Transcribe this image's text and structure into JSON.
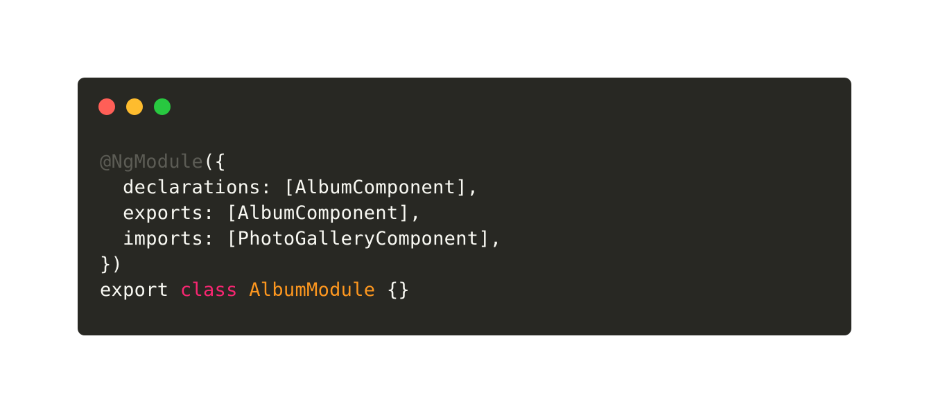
{
  "colors": {
    "page_background": "#ffffff",
    "editor_background": "#282823",
    "close_dot": "#ff5f57",
    "minimize_dot": "#febc2e",
    "maximize_dot": "#28c840",
    "plain_text": "#f8f8f2",
    "decorator": "#5c5c55",
    "keyword": "#f92672",
    "class_name": "#fd971f"
  },
  "window_controls": [
    {
      "name": "close",
      "icon": "close-dot-icon"
    },
    {
      "name": "minimize",
      "icon": "minimize-dot-icon"
    },
    {
      "name": "maximize",
      "icon": "maximize-dot-icon"
    }
  ],
  "code": {
    "lines": [
      {
        "tokens": [
          {
            "text": "@NgModule",
            "kind": "decorator"
          },
          {
            "text": "({",
            "kind": "plain"
          }
        ]
      },
      {
        "tokens": [
          {
            "text": "  declarations: [AlbumComponent],",
            "kind": "plain"
          }
        ]
      },
      {
        "tokens": [
          {
            "text": "  exports: [AlbumComponent],",
            "kind": "plain"
          }
        ]
      },
      {
        "tokens": [
          {
            "text": "  imports: [PhotoGalleryComponent],",
            "kind": "plain"
          }
        ]
      },
      {
        "tokens": [
          {
            "text": "})",
            "kind": "plain"
          }
        ]
      },
      {
        "tokens": [
          {
            "text": "export ",
            "kind": "plain"
          },
          {
            "text": "class",
            "kind": "keyword"
          },
          {
            "text": " ",
            "kind": "plain"
          },
          {
            "text": "AlbumModule",
            "kind": "class_name"
          },
          {
            "text": " {}",
            "kind": "plain"
          }
        ]
      }
    ]
  }
}
